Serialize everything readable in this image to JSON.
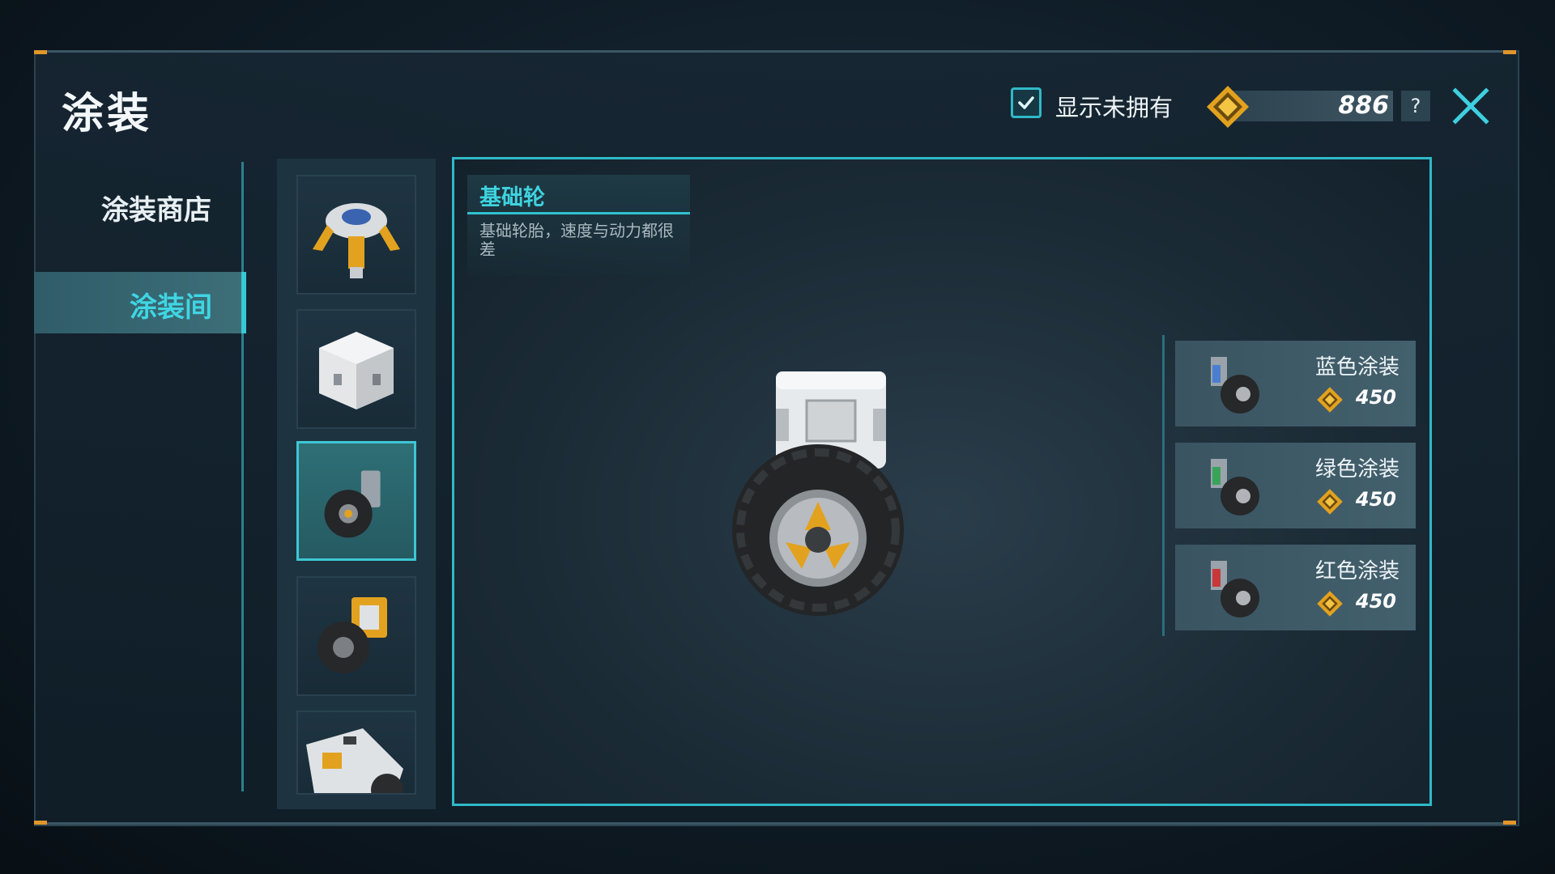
{
  "header": {
    "title": "涂装",
    "show_unowned_label": "显示未拥有",
    "show_unowned_checked": true,
    "currency_amount": "886",
    "help_label": "?"
  },
  "nav": {
    "items": [
      {
        "label": "涂装商店",
        "active": false
      },
      {
        "label": "涂装间",
        "active": true
      }
    ]
  },
  "part_thumbnails": [
    {
      "icon": "robot-walker-icon"
    },
    {
      "icon": "cube-block-icon"
    },
    {
      "icon": "basic-wheel-icon",
      "selected": true
    },
    {
      "icon": "twin-wheel-icon"
    },
    {
      "icon": "cannon-part-icon"
    }
  ],
  "selected_part": {
    "name": "基础轮",
    "description": "基础轮胎，速度与动力都很差"
  },
  "skins": [
    {
      "name": "蓝色涂装",
      "price": "450",
      "accent": "#4a7fd0"
    },
    {
      "name": "绿色涂装",
      "price": "450",
      "accent": "#3aa35a"
    },
    {
      "name": "红色涂装",
      "price": "450",
      "accent": "#c8383a"
    }
  ],
  "colors": {
    "accent_cyan": "#2fb9c8",
    "gold": "#e2a21f"
  }
}
